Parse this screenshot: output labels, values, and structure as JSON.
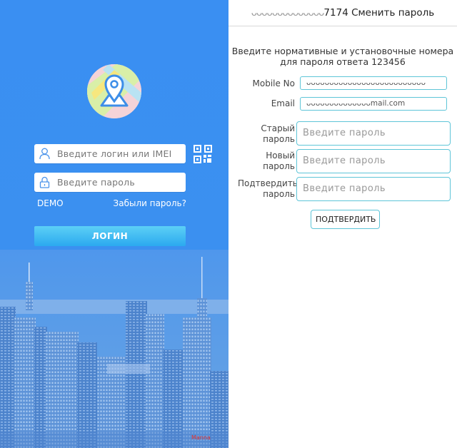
{
  "login": {
    "login_placeholder": "Введите логин или IMEI",
    "password_placeholder": "Введите  пароль",
    "demo_link": "DEMO",
    "forgot_link": "Забыли пароль?",
    "login_button": "ЛОГИН",
    "bottom_label": "Manna",
    "bottom_label_color": "#e2312c",
    "icons": [
      "map-pin-logo-icon",
      "user-icon",
      "lock-icon",
      "qr-code-icon"
    ]
  },
  "change_password": {
    "title_mask": "ᴗᴗᴗᴗᴗᴗᴗᴗᴗᴗᴗᴗᴗᴗ",
    "title_suffix": "7174 Сменить пароль",
    "instruction": "Введите нормативные и установочные номера для пароля ответа 123456",
    "mobile_label": "Mobile No",
    "mobile_value": "ᴗᴗᴗᴗᴗᴗᴗᴗᴗᴗᴗᴗᴗᴗᴗᴗᴗᴗᴗᴗᴗᴗᴗᴗᴗᴗ",
    "email_label": "Email",
    "email_value": "ᴗᴗᴗᴗᴗᴗᴗᴗᴗᴗᴗᴗᴗᴗmail.com",
    "old_password_label": "Старый пароль",
    "new_password_label": "Новый пароль",
    "confirm_password_label": "Подтвердить пароль",
    "password_placeholder": "Введите  пароль",
    "confirm_button": "ПОДТВЕРДИТЬ",
    "accent_color": "#5ec5d8"
  }
}
